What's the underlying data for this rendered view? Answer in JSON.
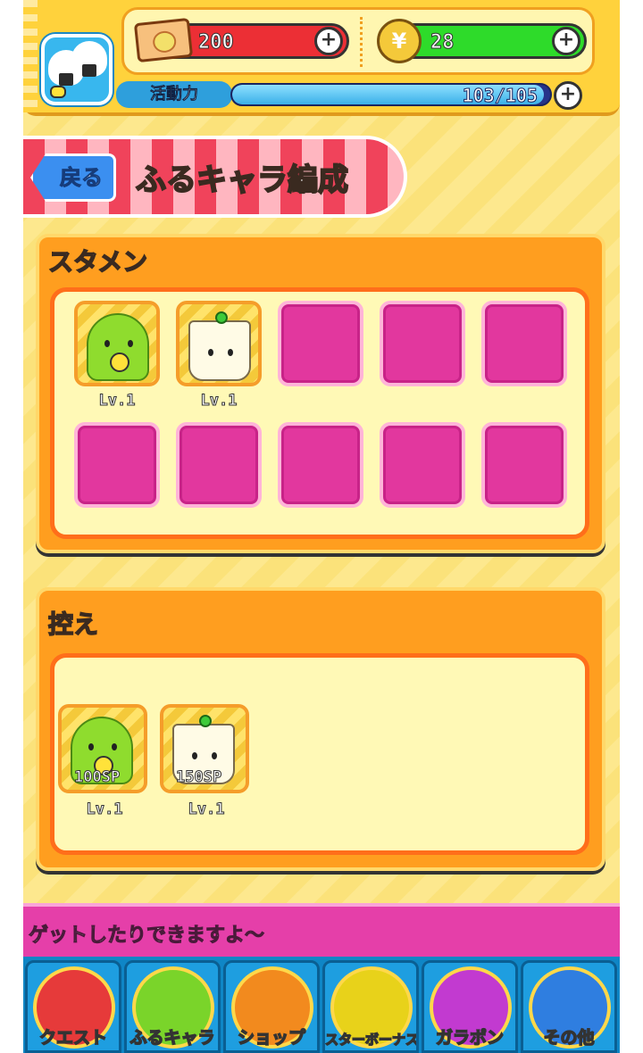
{
  "header": {
    "ticket_value": "200",
    "coin_value": "28",
    "stamina_label": "活動力",
    "stamina_text": "103/105",
    "stamina_fraction": 0.981
  },
  "title": {
    "back_label": "戻る",
    "page_title": "ふるキャラ編成"
  },
  "starter": {
    "title": "スタメン",
    "filled": [
      {
        "level": "Lv.1",
        "icon": "green-bird-chara-icon"
      },
      {
        "level": "Lv.1",
        "icon": "white-dumpling-chara-icon"
      }
    ]
  },
  "bench": {
    "title": "控え",
    "items": [
      {
        "sp": "100SP",
        "level": "Lv.1",
        "icon": "green-bird-chara-icon"
      },
      {
        "sp": "150SP",
        "level": "Lv.1",
        "icon": "white-dumpling-chara-icon"
      }
    ]
  },
  "marquee": {
    "text": "ゲットしたりできますよ～"
  },
  "nav": [
    {
      "label": "クエスト",
      "icon": "quest-tent-icon",
      "color": "#e63a3a"
    },
    {
      "label": "ふるキャラ",
      "icon": "chara-icon",
      "color": "#7ad42a"
    },
    {
      "label": "ショップ",
      "icon": "shop-ticket-icon",
      "color": "#f28a1e"
    },
    {
      "label": "スターボーナス",
      "icon": "star-icon",
      "color": "#e8d21a"
    },
    {
      "label": "ガラポン",
      "icon": "lottery-wheel-icon",
      "color": "#c23ad0"
    },
    {
      "label": "その他",
      "icon": "book-icon",
      "color": "#2f7ee0"
    }
  ]
}
